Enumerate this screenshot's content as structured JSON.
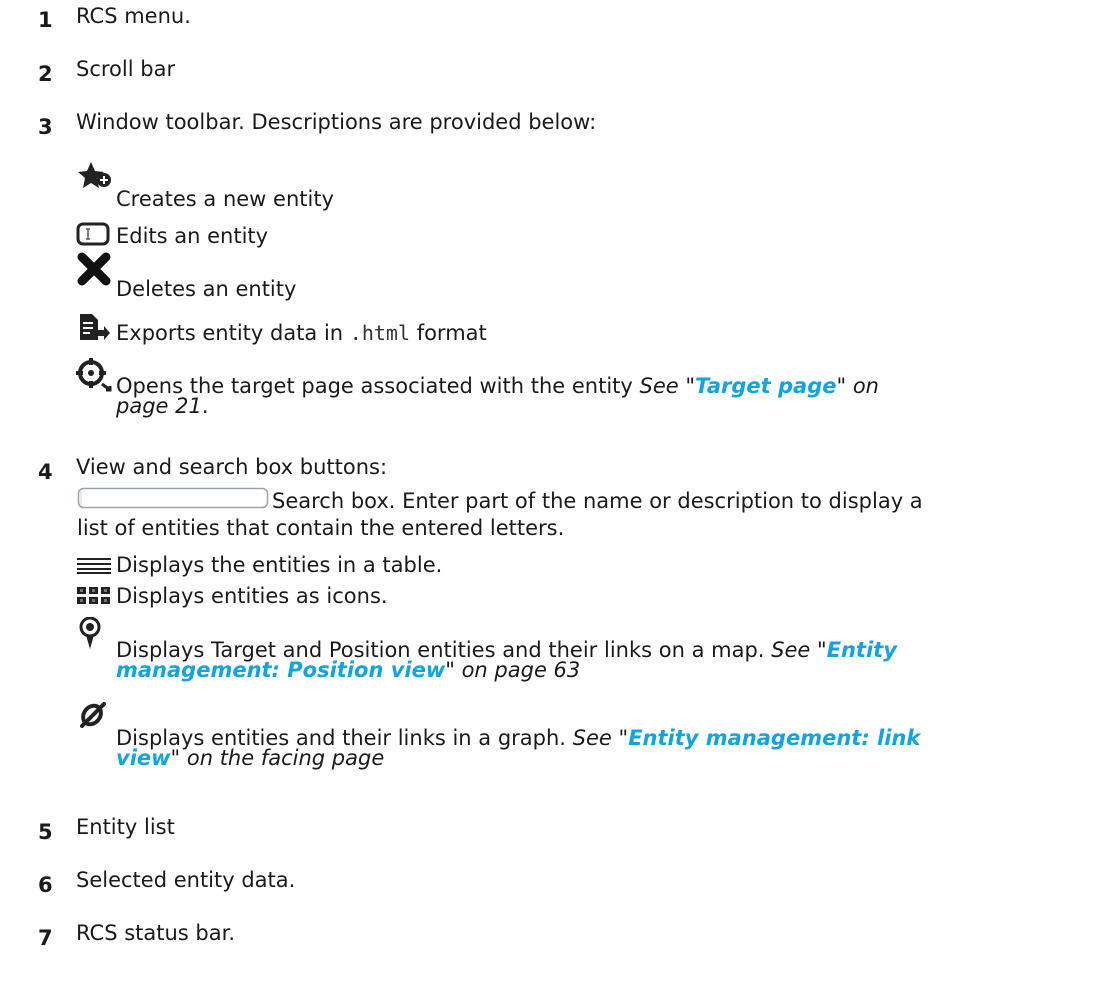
{
  "items": [
    {
      "num": "1",
      "text": "RCS menu."
    },
    {
      "num": "2",
      "text": "Scroll bar"
    },
    {
      "num": "3",
      "text": "Window toolbar. Descriptions are provided below:"
    },
    {
      "num": "4",
      "text": "View and search box buttons:"
    },
    {
      "num": "5",
      "text": "Entity list"
    },
    {
      "num": "6",
      "text": "Selected entity data."
    },
    {
      "num": "7",
      "text": "RCS status bar."
    }
  ],
  "toolbar": {
    "new_entity": "Creates a new entity",
    "edit_entity": "Edits an entity",
    "delete_entity": "Deletes an entity",
    "export_pre": "Exports entity data in ",
    "export_code": ".html",
    "export_post": " format",
    "target_text": "Opens the target page associated with the entity ",
    "target_see": "See \"",
    "target_link": "Target page",
    "target_on": "\" on",
    "target_page": "page 21",
    "target_end": "."
  },
  "view": {
    "search_line1": "Search box. Enter part of the name or description to display a",
    "search_line2": "list of entities that contain the entered letters.",
    "table_text": "Displays the entities in a table.",
    "icons_text": "Displays entities as icons.",
    "map_text": "Displays Target and Position entities and their links on a map. ",
    "map_see": "See \"",
    "map_link1": "Entity",
    "map_link2": "management: Position view",
    "map_on": "\" on page 63",
    "graph_text": "Displays entities and their links in a graph. ",
    "graph_see": "See \"",
    "graph_link1": "Entity management: link",
    "graph_link2": "view",
    "graph_on": "\" on the facing page"
  },
  "icons": {
    "new_entity": "star-plus-icon",
    "edit_entity": "text-field-icon",
    "delete_entity": "x-icon",
    "export": "document-export-icon",
    "target": "target-page-icon",
    "search": "search-box-icon",
    "table_view": "table-view-icon",
    "icon_view": "grid-view-icon",
    "map_view": "map-pin-icon",
    "graph_view": "graph-link-icon"
  },
  "colors": {
    "text": "#1a1a1a",
    "link": "#12a3e0"
  }
}
